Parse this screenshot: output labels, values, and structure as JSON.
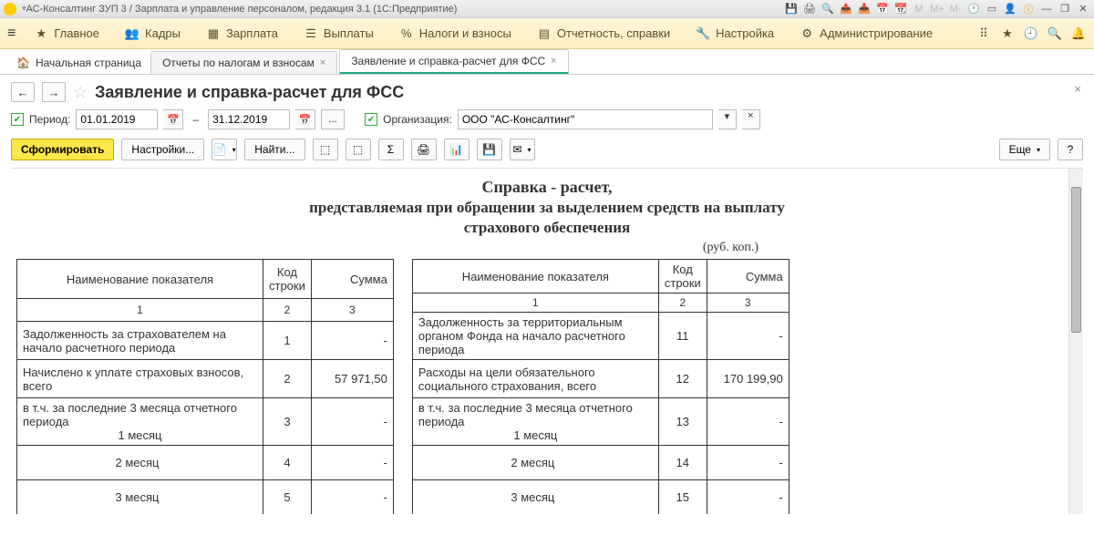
{
  "titlebar": {
    "title": "АС-Консалтинг ЗУП 3 / Зарплата и управление персоналом, редакция 3.1  (1С:Предприятие)"
  },
  "mainmenu": {
    "items": [
      {
        "label": "Главное"
      },
      {
        "label": "Кадры"
      },
      {
        "label": "Зарплата"
      },
      {
        "label": "Выплаты"
      },
      {
        "label": "Налоги и взносы"
      },
      {
        "label": "Отчетность, справки"
      },
      {
        "label": "Настройка"
      },
      {
        "label": "Администрирование"
      }
    ]
  },
  "tabs": {
    "home": "Начальная страница",
    "t1": "Отчеты по налогам и взносам",
    "t2": "Заявление и справка-расчет для ФСС"
  },
  "page": {
    "title": "Заявление и справка-расчет для ФСС",
    "period_label": "Период:",
    "date_from": "01.01.2019",
    "date_to": "31.12.2019",
    "org_label": "Организация:",
    "org_value": "ООО \"АС-Консалтинг\""
  },
  "toolbar": {
    "form": "Сформировать",
    "settings": "Настройки...",
    "find": "Найти...",
    "more": "Еще",
    "help": "?"
  },
  "report": {
    "title": "Справка - расчет,",
    "sub1": "представляемая при обращении за выделением средств на выплату",
    "sub2": "страхового обеспечения",
    "unit": "(руб. коп.)",
    "headers": {
      "name": "Наименование показателя",
      "code": "Код строки",
      "sum": "Сумма"
    },
    "nums": {
      "c1": "1",
      "c2": "2",
      "c3": "3"
    },
    "left": [
      {
        "name": "Задолженность за страхователем на начало расчетного периода",
        "code": "1",
        "sum": "-"
      },
      {
        "name": "Начислено к уплате страховых взносов, всего",
        "code": "2",
        "sum": "57 971,50"
      },
      {
        "name": "в т.ч. за последние 3 месяца отчетного периода",
        "sub": "1 месяц",
        "code": "3",
        "sum": "-"
      },
      {
        "name": "2 месяц",
        "code": "4",
        "sum": "-",
        "center": true
      },
      {
        "name": "3 месяц",
        "code": "5",
        "sum": "-",
        "center": true
      }
    ],
    "right": [
      {
        "name": "Задолженность за территориальным органом Фонда на  начало расчетного периода",
        "code": "11",
        "sum": "-"
      },
      {
        "name": "Расходы на цели обязательного социального страхования, всего",
        "code": "12",
        "sum": "170 199,90"
      },
      {
        "name": "в т.ч. за последние 3 месяца отчетного периода",
        "sub": "1 месяц",
        "code": "13",
        "sum": "-"
      },
      {
        "name": "2 месяц",
        "code": "14",
        "sum": "-",
        "center": true
      },
      {
        "name": "3 месяц",
        "code": "15",
        "sum": "-",
        "center": true
      }
    ]
  }
}
